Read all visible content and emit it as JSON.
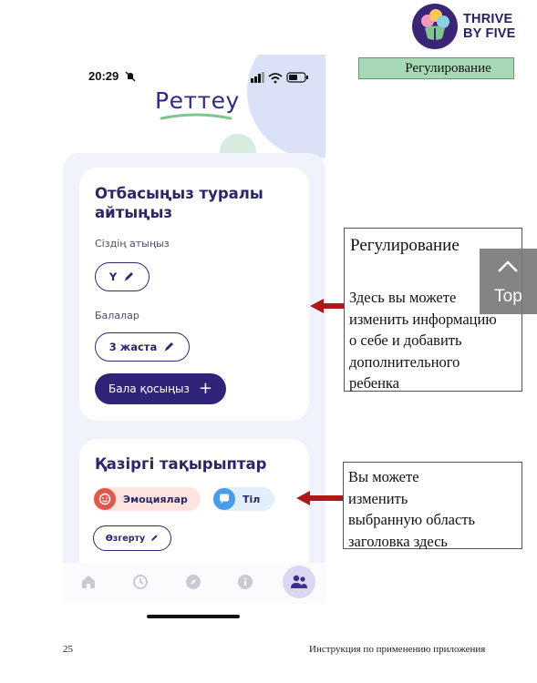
{
  "logo": {
    "line1": "THRIVE",
    "line2": "BY FIVE"
  },
  "section_tag": "Регулирование",
  "phone": {
    "time": "20:29",
    "app_title": "Реттеу",
    "family_card": {
      "heading": "Отбасыңыз туралы айтыңыз",
      "name_label": "Сіздің атыңыз",
      "name_value": "Y",
      "children_label": "Балалар",
      "child_value": "3 жаста",
      "add_child_label": "Бала қосыңыз"
    },
    "topics_card": {
      "heading": "Қазіргі тақырыптар",
      "chips": [
        {
          "label": "Эмоциялар",
          "color": "#e2574c"
        },
        {
          "label": "Тіл",
          "color": "#4a9be8"
        }
      ],
      "change_label": "Өзгерту"
    },
    "tabs": [
      "home-icon",
      "history-icon",
      "explore-icon",
      "info-icon",
      "family-icon"
    ],
    "active_tab": "family-icon"
  },
  "callouts": {
    "first": {
      "title": "Регулирование",
      "lines": [
        "Здесь вы можете",
        "изменить информацию",
        "о себе и добавить",
        "дополнительного",
        "ребенка"
      ]
    },
    "second": {
      "lines": [
        "Вы можете",
        "изменить",
        "выбранную область",
        "заголовка здесь"
      ]
    }
  },
  "top_button": "Top",
  "accent_colors": {
    "brand_purple": "#2f2478",
    "tag_green": "#a7d9b6",
    "arrow_red": "#b1181b"
  },
  "footer": {
    "page_number": "25",
    "text": "Инструкция по применению приложения"
  }
}
